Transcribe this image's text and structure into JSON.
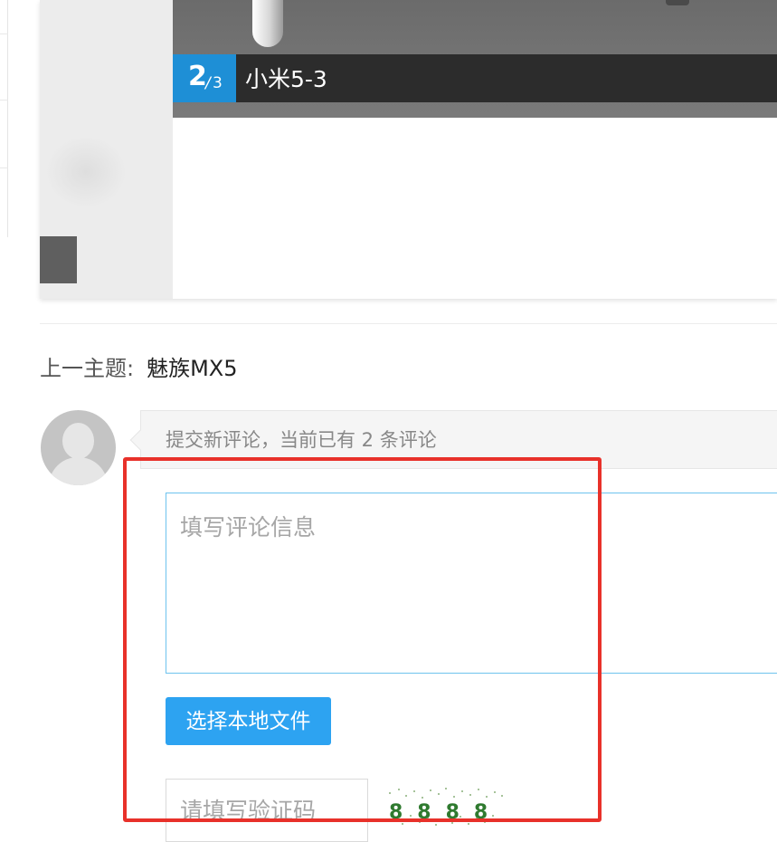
{
  "gallery": {
    "current_index": "2",
    "separator": "/",
    "total": "3",
    "caption": "小米5-3"
  },
  "nav": {
    "prev_label": "上一主题:",
    "prev_title": "魅族MX5"
  },
  "comments": {
    "header_text": "提交新评论，当前已有 2 条评论",
    "textarea_placeholder": "填写评论信息",
    "file_button_label": "选择本地文件",
    "captcha_placeholder": "请填写验证码",
    "captcha_text": "8888"
  },
  "colors": {
    "accent_blue": "#2da3f1",
    "counter_blue": "#1e8fd6",
    "highlight_red": "#e8312a"
  }
}
